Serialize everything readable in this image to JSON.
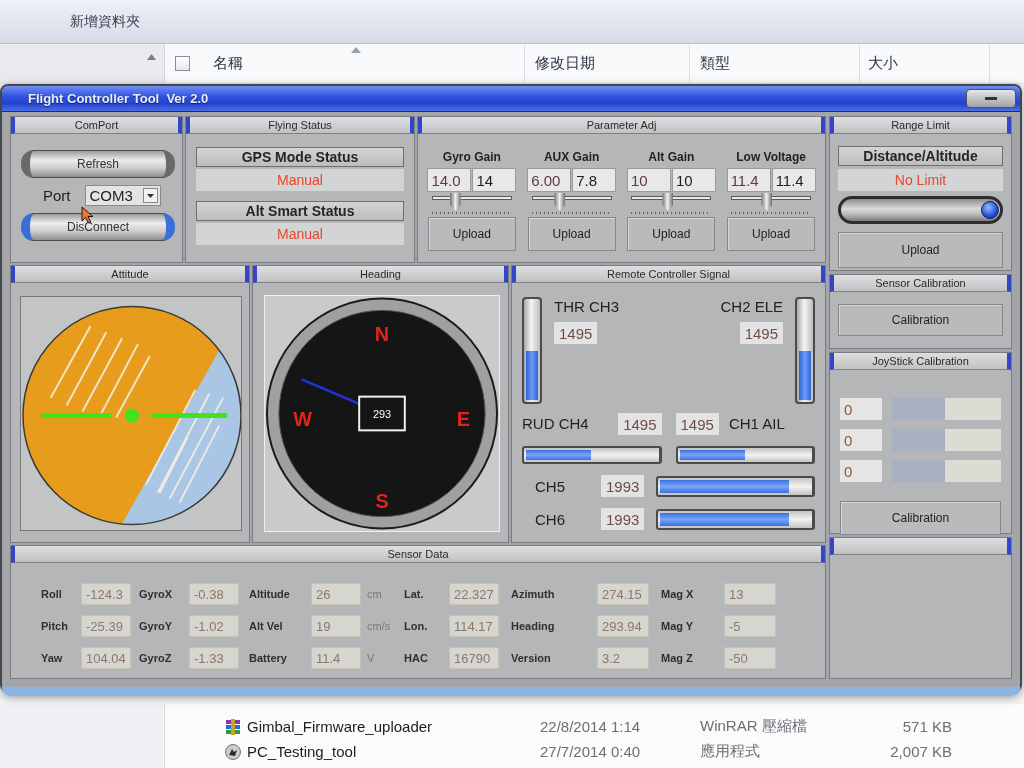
{
  "explorer": {
    "toolbar": {
      "new_folder": "新增資料夾"
    },
    "select_all": {
      "checked": false
    },
    "columns": [
      "名稱",
      "修改日期",
      "類型",
      "大小"
    ],
    "files": [
      {
        "kind": "archive",
        "name": "Gimbal_Firmware_uploader",
        "modified": "22/8/2014 1:14",
        "type": "WinRAR 壓縮檔",
        "size": "571 KB"
      },
      {
        "kind": "app",
        "name": "PC_Testing_tool",
        "modified": "27/7/2014 0:40",
        "type": "應用程式",
        "size": "2,007 KB"
      }
    ]
  },
  "window": {
    "title": "Flight Controller Tool  Ver 2.0"
  },
  "comport": {
    "title": "ComPort",
    "refresh": "Refresh",
    "port_label": "Port",
    "port_value": "COM3",
    "disconnect": "DisConnect"
  },
  "flying_status": {
    "title": "Flying Status",
    "items": [
      {
        "label": "GPS Mode Status",
        "value": "Manual"
      },
      {
        "label": "Alt Smart Status",
        "value": "Manual"
      }
    ]
  },
  "parameter_adj": {
    "title": "Parameter Adj",
    "params": [
      {
        "label": "Gyro Gain",
        "current": "14.0",
        "target": "14",
        "level": 0.26,
        "button": "Upload"
      },
      {
        "label": "AUX Gain",
        "current": "6.00",
        "target": "7.8",
        "level": 0.33,
        "button": "Upload"
      },
      {
        "label": "Alt Gain",
        "current": "10",
        "target": "10",
        "level": 0.45,
        "button": "Upload"
      },
      {
        "label": "Low Voltage",
        "current": "11.4",
        "target": "11.4",
        "level": 0.44,
        "button": "Upload"
      }
    ]
  },
  "range_limit": {
    "title": "Range Limit",
    "label": "Distance/Altitude",
    "value": "No Limit",
    "level": 1,
    "button": "Upload"
  },
  "attitude": {
    "title": "Attitude"
  },
  "heading": {
    "title": "Heading",
    "value": "293",
    "cardinals": [
      "N",
      "E",
      "S",
      "W"
    ]
  },
  "remote_signal": {
    "title": "Remote Controller Signal",
    "sticks": [
      {
        "label": "THR CH3",
        "value": "1495",
        "level": 0.5
      },
      {
        "label": "CH2 ELE",
        "value": "1495",
        "level": 0.5
      }
    ],
    "axes": [
      {
        "label": "RUD CH4",
        "value": "1495",
        "level": 0.5
      },
      {
        "label": "CH1 AIL",
        "value": "1495",
        "level": 0.5
      }
    ],
    "aux": [
      {
        "label": "CH5",
        "value": "1993",
        "level": 0.86
      },
      {
        "label": "CH6",
        "value": "1993",
        "level": 0.86
      }
    ]
  },
  "sensor_calibration": {
    "title": "Sensor Calibration",
    "button": "Calibration"
  },
  "joystick_calibration": {
    "title": "JoyStick Calibration",
    "rows": [
      {
        "value": "0",
        "level": 0.49
      },
      {
        "value": "0",
        "level": 0.49
      },
      {
        "value": "0",
        "level": 0.49
      }
    ],
    "button": "Calibration"
  },
  "sensor_data": {
    "title": "Sensor Data",
    "groups": [
      [
        {
          "label": "Roll",
          "value": "-124.3"
        },
        {
          "label": "Pitch",
          "value": "-25.39"
        },
        {
          "label": "Yaw",
          "value": "104.04"
        }
      ],
      [
        {
          "label": "GyroX",
          "value": "-0.38"
        },
        {
          "label": "GyroY",
          "value": "-1.02"
        },
        {
          "label": "GyroZ",
          "value": "-1.33"
        }
      ],
      [
        {
          "label": "Altitude",
          "value": "26",
          "unit": "cm"
        },
        {
          "label": "Alt Vel",
          "value": "19",
          "unit": "cm/s"
        },
        {
          "label": "Battery",
          "value": "11.4",
          "unit": "V"
        }
      ],
      [
        {
          "label": "Lat.",
          "value": "22.327"
        },
        {
          "label": "Lon.",
          "value": "114.17"
        },
        {
          "label": "HAC",
          "value": "16790"
        }
      ],
      [
        {
          "label": "Azimuth",
          "value": "274.15"
        },
        {
          "label": "Heading",
          "value": "293.94"
        },
        {
          "label": "Version",
          "value": "3.2"
        }
      ],
      [
        {
          "label": "Mag X",
          "value": "13"
        },
        {
          "label": "Mag Y",
          "value": "-5"
        },
        {
          "label": "Mag Z",
          "value": "-50"
        }
      ]
    ]
  }
}
